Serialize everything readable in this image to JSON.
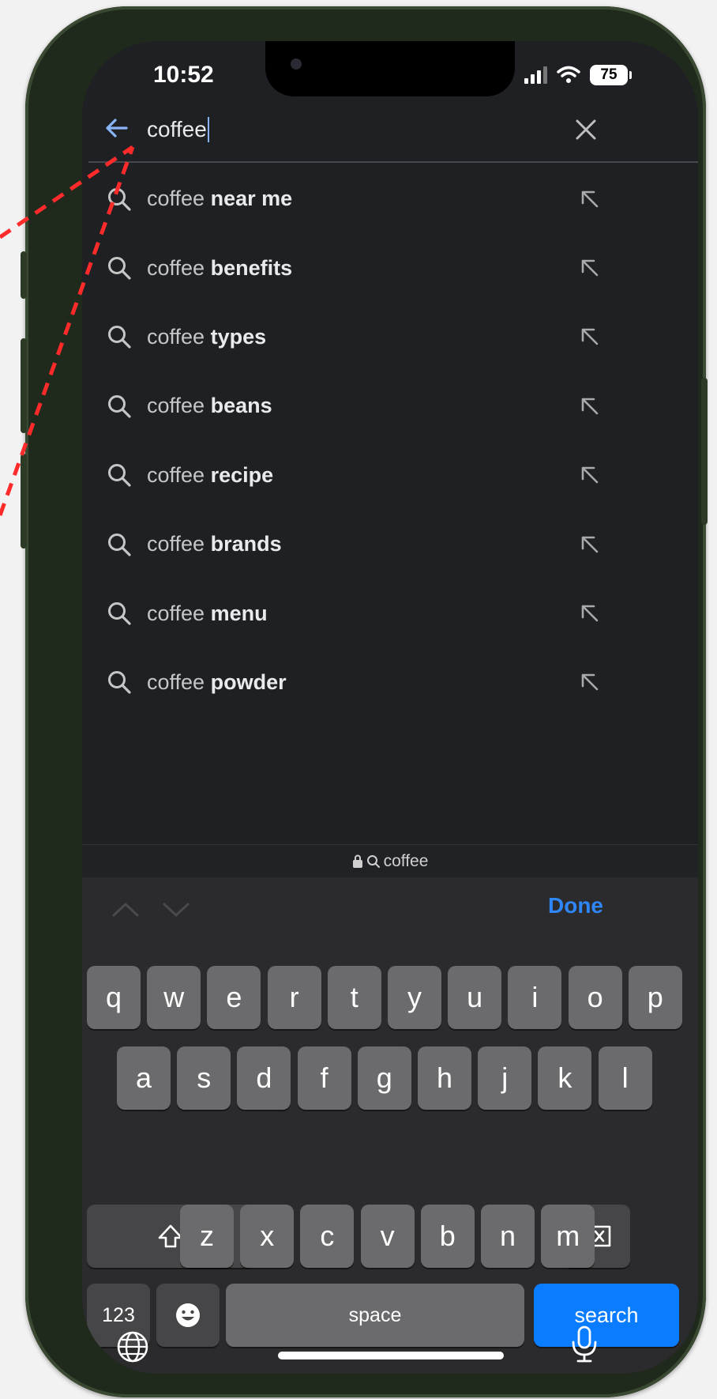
{
  "status": {
    "time": "10:52",
    "battery": "75"
  },
  "search": {
    "query": "coffee"
  },
  "suggestions": [
    {
      "prefix": "coffee",
      "completion": "near me"
    },
    {
      "prefix": "coffee",
      "completion": "benefits"
    },
    {
      "prefix": "coffee",
      "completion": "types"
    },
    {
      "prefix": "coffee",
      "completion": "beans"
    },
    {
      "prefix": "coffee",
      "completion": "recipe"
    },
    {
      "prefix": "coffee",
      "completion": "brands"
    },
    {
      "prefix": "coffee",
      "completion": "menu"
    },
    {
      "prefix": "coffee",
      "completion": "powder"
    }
  ],
  "url_bar": {
    "text": "coffee"
  },
  "keyboard": {
    "done_label": "Done",
    "row1": [
      "q",
      "w",
      "e",
      "r",
      "t",
      "y",
      "u",
      "i",
      "o",
      "p"
    ],
    "row2": [
      "a",
      "s",
      "d",
      "f",
      "g",
      "h",
      "j",
      "k",
      "l"
    ],
    "row3": [
      "z",
      "x",
      "c",
      "v",
      "b",
      "n",
      "m"
    ],
    "numbers_label": "123",
    "space_label": "space",
    "search_label": "search"
  },
  "colors": {
    "screen_bg": "#1f2024",
    "accent_blue": "#8ab4f8",
    "done_blue": "#2f86f6",
    "search_key": "#0a7cff",
    "annotation": "#ff2a2a"
  }
}
